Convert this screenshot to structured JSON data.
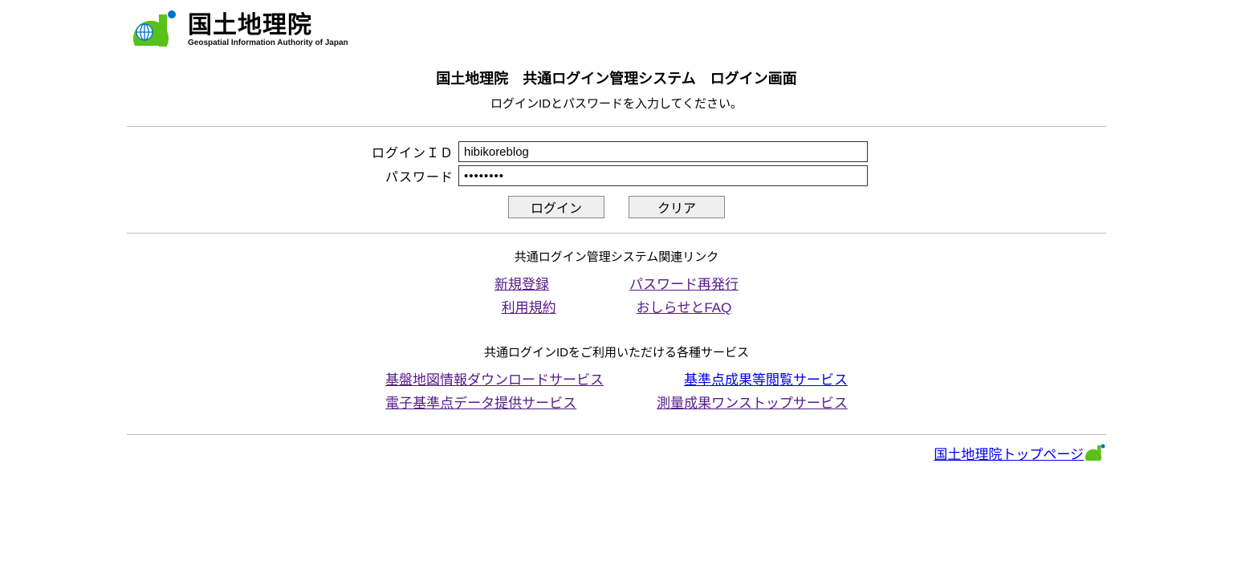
{
  "logo": {
    "jp_name": "国土地理院",
    "en_name": "Geospatial Information Authority of Japan"
  },
  "header": {
    "title": "国土地理院　共通ログイン管理システム　ログイン画面",
    "instruction": "ログインIDとパスワードを入力してください。"
  },
  "form": {
    "id_label": "ログインＩＤ",
    "id_value": "hibikoreblog",
    "pw_label": "パスワード",
    "pw_value": "••••••••",
    "login_btn": "ログイン",
    "clear_btn": "クリア"
  },
  "links": {
    "related_header": "共通ログイン管理システム関連リンク",
    "register": "新規登録",
    "reissue": "パスワード再発行",
    "terms": "利用規約",
    "faq": "おしらせとFAQ",
    "services_header": "共通ログインIDをご利用いただける各種サービス",
    "svc1": "基盤地図情報ダウンロードサービス",
    "svc2": "基準点成果等閲覧サービス",
    "svc3": "電子基準点データ提供サービス",
    "svc4": "測量成果ワンストップサービス"
  },
  "footer": {
    "home_link": "国土地理院トップページ"
  }
}
